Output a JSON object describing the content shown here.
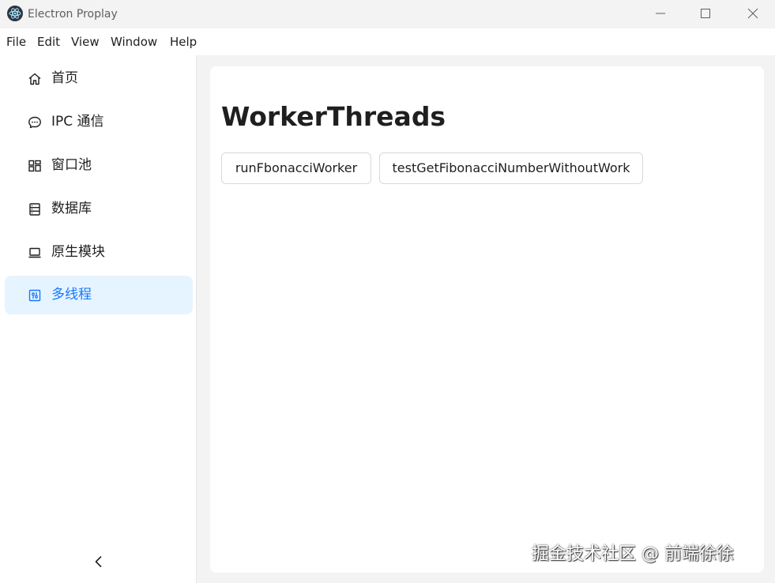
{
  "window": {
    "title": "Electron Proplay"
  },
  "menubar": {
    "items": [
      "File",
      "Edit",
      "View",
      "Window",
      "Help"
    ]
  },
  "sidebar": {
    "items": [
      {
        "label": "首页",
        "icon": "home-icon"
      },
      {
        "label": "IPC 通信",
        "icon": "message-icon"
      },
      {
        "label": "窗口池",
        "icon": "windows-icon"
      },
      {
        "label": "数据库",
        "icon": "database-icon"
      },
      {
        "label": "原生模块",
        "icon": "laptop-icon"
      },
      {
        "label": "多线程",
        "icon": "sliders-icon",
        "active": true
      }
    ],
    "collapse_icon": "chevron-left-icon"
  },
  "main": {
    "title": "WorkerThreads",
    "buttons": [
      "runFbonacciWorker",
      "testGetFibonacciNumberWithoutWork"
    ]
  },
  "watermark": "掘金技术社区 @ 前端徐徐",
  "colors": {
    "accent": "#1677ff",
    "active_bg": "#e6f4ff"
  }
}
